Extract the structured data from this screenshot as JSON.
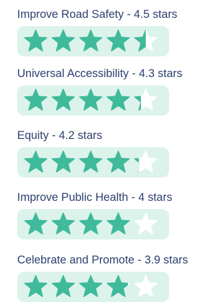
{
  "colors": {
    "label_text": "#2c3f6d",
    "pill_background": "#dcf3ec",
    "star_filled": "#3fba9a",
    "star_empty": "#ffffff"
  },
  "star_icon": "star-icon",
  "max_stars": 5,
  "ratings": [
    {
      "label": "Improve Road Safety - 4.5 stars",
      "value": 4.5
    },
    {
      "label": "Universal Accessibility - 4.3 stars",
      "value": 4.3
    },
    {
      "label": "Equity - 4.2 stars",
      "value": 4.2
    },
    {
      "label": "Improve Public Health - 4 stars",
      "value": 4
    },
    {
      "label": "Celebrate and Promote - 3.9 stars",
      "value": 3.9
    }
  ]
}
